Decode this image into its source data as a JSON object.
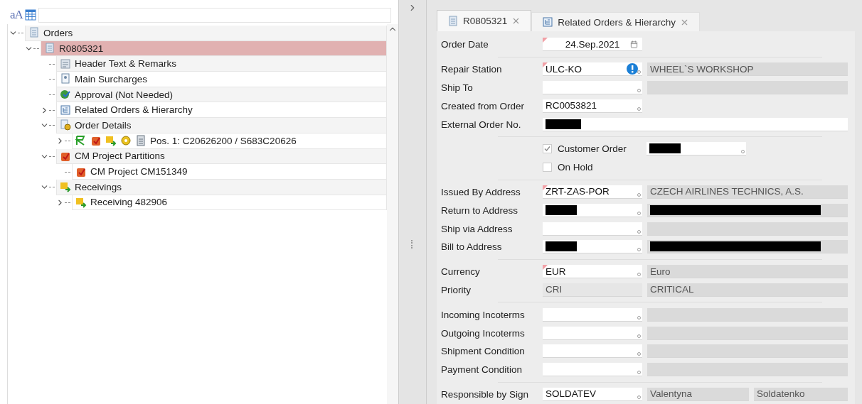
{
  "toolbar": {
    "font_button": "aA"
  },
  "tree": [
    {
      "label": "Orders",
      "kind": "document",
      "expanded": true,
      "selected": false,
      "children": [
        {
          "label": "R0805321",
          "kind": "document",
          "expanded": true,
          "selected": true,
          "children": [
            {
              "label": "Header Text & Remarks",
              "kind": "text",
              "selected": false
            },
            {
              "label": "Main Surcharges",
              "kind": "surcharge",
              "selected": false
            },
            {
              "label": "Approval (Not Needed)",
              "kind": "approval",
              "selected": false
            },
            {
              "label": "Related Orders & Hierarchy",
              "kind": "hierarchy",
              "expanded": false,
              "selected": false
            },
            {
              "label": "Order Details",
              "kind": "details",
              "expanded": true,
              "selected": false,
              "children": [
                {
                  "label": "Pos. 1: C20626200 / S683C20626",
                  "kind": "position",
                  "expanded": false,
                  "selected": false
                }
              ]
            },
            {
              "label": "CM Project Partitions",
              "kind": "project",
              "expanded": true,
              "selected": false,
              "children": [
                {
                  "label": "CM Project CM151349",
                  "kind": "project",
                  "selected": false
                }
              ]
            },
            {
              "label": "Receivings",
              "kind": "receiving",
              "expanded": true,
              "selected": false,
              "children": [
                {
                  "label": "Receiving 482906",
                  "kind": "receiving",
                  "expanded": false,
                  "selected": false
                }
              ]
            }
          ]
        }
      ]
    }
  ],
  "tabs": [
    {
      "label": "R0805321",
      "kind": "document",
      "selected": true
    },
    {
      "label": "Related Orders & Hierarchy",
      "kind": "hierarchy",
      "selected": false
    }
  ],
  "form": [
    {
      "kind": "field",
      "label": "Order Date",
      "fields": [
        {
          "kind": "date",
          "value": "24.Sep.2021",
          "required": true
        }
      ]
    },
    {
      "kind": "divider"
    },
    {
      "kind": "field",
      "label": "Repair Station",
      "fields": [
        {
          "kind": "lookup",
          "value": "ULC-KO",
          "required": true,
          "info": true
        },
        {
          "kind": "display",
          "value": "WHEEL`S WORKSHOP"
        }
      ]
    },
    {
      "kind": "field",
      "label": "Ship To",
      "fields": [
        {
          "kind": "lookup"
        },
        {
          "kind": "display"
        }
      ]
    },
    {
      "kind": "field",
      "label": "Created from Order",
      "fields": [
        {
          "kind": "lookup",
          "value": "RC0053821"
        }
      ]
    },
    {
      "kind": "field",
      "label": "External Order No.",
      "fields": [
        {
          "kind": "wide",
          "redacted": true
        }
      ]
    },
    {
      "kind": "divider"
    },
    {
      "kind": "checkbox",
      "label": "Customer Order",
      "checked": true,
      "fields": [
        {
          "kind": "lookup",
          "redacted": true
        }
      ]
    },
    {
      "kind": "checkbox",
      "label": "On Hold",
      "checked": false
    },
    {
      "kind": "divider"
    },
    {
      "kind": "field",
      "label": "Issued By Address",
      "fields": [
        {
          "kind": "lookup",
          "value": "ZRT-ZAS-POR",
          "required": true
        },
        {
          "kind": "display",
          "value": "CZECH AIRLINES TECHNICS, A.S."
        }
      ]
    },
    {
      "kind": "field",
      "label": "Return to Address",
      "fields": [
        {
          "kind": "lookup",
          "redacted": true
        },
        {
          "kind": "display",
          "redacted": true
        }
      ]
    },
    {
      "kind": "field",
      "label": "Ship via Address",
      "fields": [
        {
          "kind": "lookup"
        },
        {
          "kind": "display"
        }
      ]
    },
    {
      "kind": "field",
      "label": "Bill to Address",
      "fields": [
        {
          "kind": "lookup",
          "redacted": true
        },
        {
          "kind": "display",
          "redacted": true
        }
      ]
    },
    {
      "kind": "divider"
    },
    {
      "kind": "field",
      "label": "Currency",
      "fields": [
        {
          "kind": "lookup",
          "value": "EUR",
          "required": true
        },
        {
          "kind": "display",
          "value": "Euro"
        }
      ]
    },
    {
      "kind": "field",
      "label": "Priority",
      "fields": [
        {
          "kind": "readonly",
          "value": "CRI"
        },
        {
          "kind": "display",
          "value": "CRITICAL"
        }
      ]
    },
    {
      "kind": "divider"
    },
    {
      "kind": "field",
      "label": "Incoming Incoterms",
      "fields": [
        {
          "kind": "lookup"
        },
        {
          "kind": "display"
        }
      ]
    },
    {
      "kind": "field",
      "label": "Outgoing Incoterms",
      "fields": [
        {
          "kind": "lookup"
        },
        {
          "kind": "display"
        }
      ]
    },
    {
      "kind": "field",
      "label": "Shipment Condition",
      "fields": [
        {
          "kind": "lookup"
        },
        {
          "kind": "display"
        }
      ]
    },
    {
      "kind": "field",
      "label": "Payment Condition",
      "fields": [
        {
          "kind": "lookup"
        },
        {
          "kind": "display"
        }
      ]
    },
    {
      "kind": "divider"
    },
    {
      "kind": "field",
      "label": "Responsible by Sign",
      "fields": [
        {
          "kind": "lookup",
          "value": "SOLDATEV"
        },
        {
          "kind": "half",
          "value": "Valentyna"
        },
        {
          "kind": "half",
          "value": "Soldatenko"
        }
      ]
    }
  ]
}
